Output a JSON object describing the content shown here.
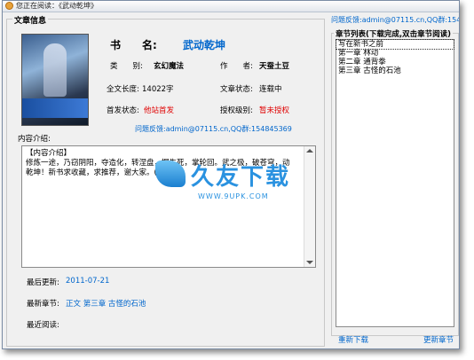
{
  "window": {
    "title": "您正在阅读：《武动乾坤》"
  },
  "article_info": {
    "group_title": "文章信息",
    "book_label": "书　　名:",
    "book_name": "武动乾坤",
    "category_label": "类　　别:",
    "category_value": "玄幻魔法",
    "author_label": "作　　者:",
    "author_value": "天蚕土豆",
    "length_label": "全文长度:",
    "length_value": "14022字",
    "status_label": "文章状态:",
    "status_value": "连载中",
    "first_label": "首发状态:",
    "first_value": "他站首发",
    "auth_label": "授权级别:",
    "auth_value": "暂未授权",
    "feedback_line": "问题反馈:admin@07115.cn,QQ群:154845369",
    "intro_label": "内容介绍:",
    "intro_text": "【内容介绍】\n修炼一途，乃窃阴阳，夺造化，转涅盘，握生死，掌轮回。武之极，破苍穹，动乾坤！新书求收藏，求推荐，谢大家。(*^_^*)",
    "last_update_label": "最后更新:",
    "last_update_value": "2011-07-21",
    "latest_chapter_label": "最新章节:",
    "latest_chapter_value": "正文 第三章 古怪的石池",
    "recent_read_label": "最近阅读:"
  },
  "right_panel": {
    "feedback": "问题反馈:admin@07115.cn,QQ群:154845",
    "chapter_group_title": "章节列表(下载完成,双击章节阅读)",
    "chapters": [
      "写在新书之前",
      "第一章 林动",
      "第二章 通背拳",
      "第三章 古怪的石池"
    ],
    "redownload": "重新下载",
    "update_chapter": "更新章节"
  },
  "watermark": {
    "cn": "久友下载",
    "en": "WWW.9UPK.COM"
  }
}
